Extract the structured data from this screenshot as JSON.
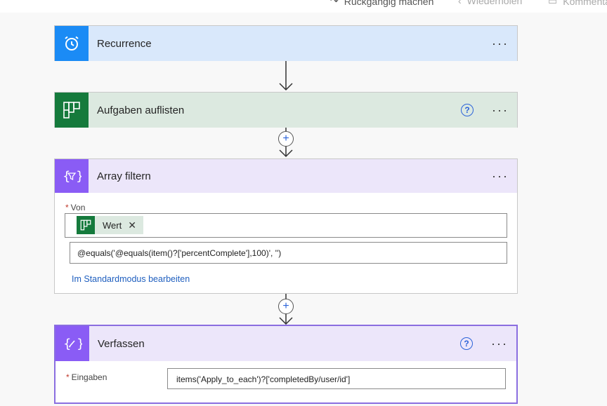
{
  "toolbar": {
    "undo_label": "Rückgängig machen",
    "redo_label": "Wiederholen",
    "comment_label": "Kommentar"
  },
  "steps": {
    "recurrence": {
      "title": "Recurrence",
      "icon": "alarm-clock-icon",
      "color": "#1b8bf5"
    },
    "aufgaben": {
      "title": "Aufgaben auflisten",
      "icon": "planner-icon",
      "color": "#157a3c"
    },
    "filter": {
      "title": "Array filtern",
      "icon": "filter-braces-icon",
      "color": "#8a5cf5",
      "from_label": "Von",
      "token_label": "Wert",
      "expression": "@equals('@equals(item()?['percentComplete'],100)', '')",
      "advanced_link": "Im Standardmodus bearbeiten"
    },
    "compose": {
      "title": "Verfassen",
      "icon": "compose-braces-icon",
      "color": "#8a5cf5",
      "inputs_label": "Eingaben",
      "inputs_value": "items('Apply_to_each')?['completedBy/user/id']"
    }
  },
  "more_label": "···",
  "help_label": "?",
  "required_marker": "*"
}
